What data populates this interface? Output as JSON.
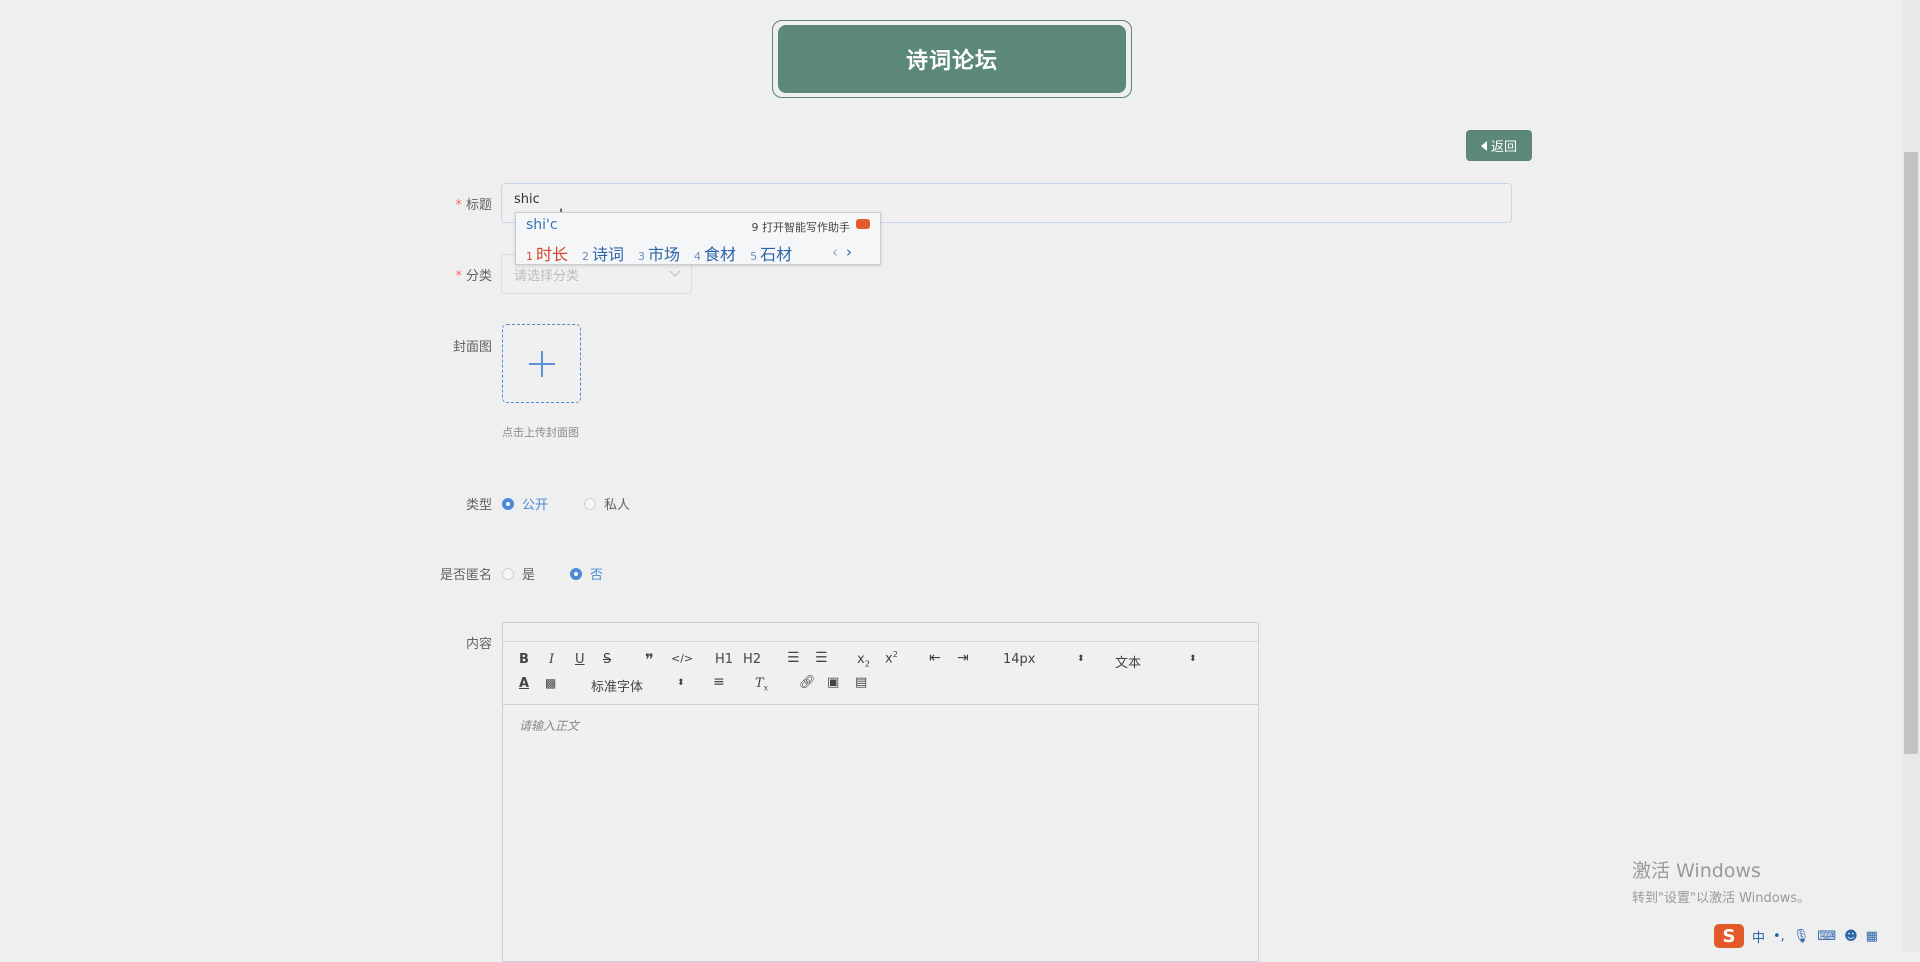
{
  "header": {
    "title": "诗词论坛"
  },
  "back_button": {
    "label": "返回"
  },
  "form": {
    "title": {
      "label": "标题",
      "value": "shic"
    },
    "category": {
      "label": "分类",
      "placeholder": "请选择分类"
    },
    "cover": {
      "label": "封面图",
      "hint": "点击上传封面图"
    },
    "type": {
      "label": "类型",
      "options": [
        "公开",
        "私人"
      ],
      "selected": "公开"
    },
    "anonymous": {
      "label": "是否匿名",
      "options": [
        "是",
        "否"
      ],
      "selected": "否"
    },
    "content": {
      "label": "内容",
      "placeholder": "请输入正文"
    }
  },
  "editor_toolbar": {
    "font_size": "14px",
    "block_format": "文本",
    "font_family": "标准字体",
    "h1": "H1",
    "h2": "H2",
    "bold": "B",
    "italic": "I",
    "underline": "U",
    "strike": "S"
  },
  "ime": {
    "composition": "shi'c",
    "assistant": "9 打开智能写作助手",
    "candidates": [
      {
        "n": "1",
        "text": "时长"
      },
      {
        "n": "2",
        "text": "诗词"
      },
      {
        "n": "3",
        "text": "市场"
      },
      {
        "n": "4",
        "text": "食材"
      },
      {
        "n": "5",
        "text": "石材"
      }
    ]
  },
  "watermark": {
    "line1": "激活 Windows",
    "line2": "转到\"设置\"以激活 Windows。"
  },
  "tray": {
    "ime_mode": "中"
  }
}
